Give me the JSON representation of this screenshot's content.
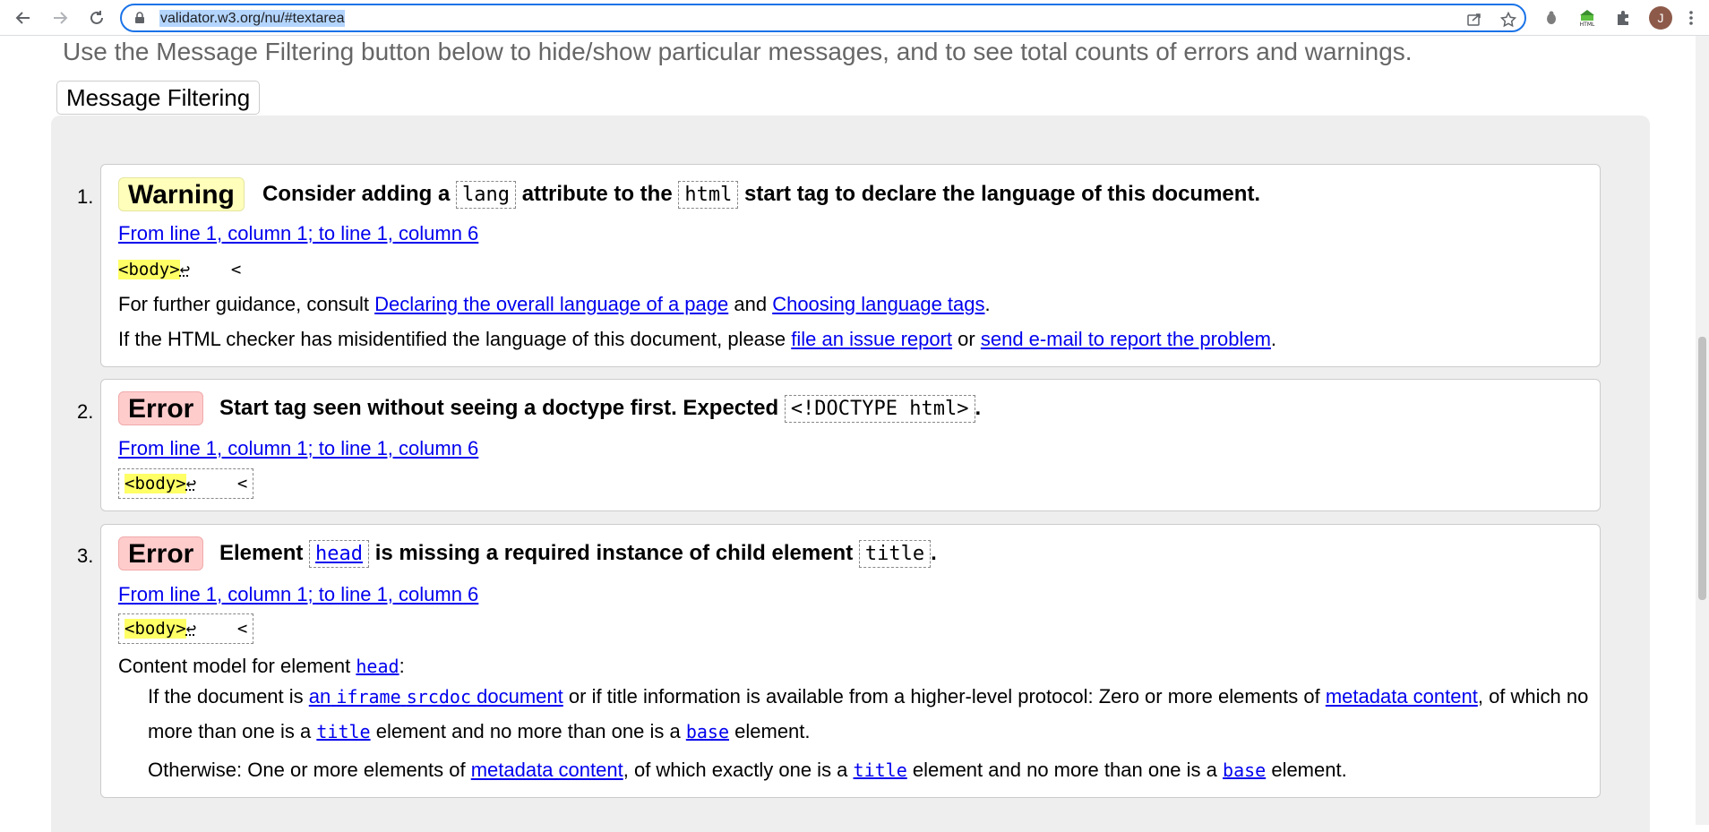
{
  "browser": {
    "url": "validator.w3.org/nu/#textarea",
    "avatar_letter": "J"
  },
  "page": {
    "intro": "Use the Message Filtering button below to hide/show particular messages, and to see total counts of errors and warnings.",
    "filter_button": "Message Filtering"
  },
  "messages": [
    {
      "number": "1.",
      "type": "Warning",
      "text_parts": [
        "Consider adding a",
        "lang",
        "attribute to the",
        "html",
        "start tag to declare the language of this document."
      ],
      "location": "From line 1, column 1; to line 1, column 6",
      "extract_tag": "<body>",
      "extract_ret": "↩",
      "extract_tail": "    <",
      "guidance": {
        "prefix": "For further guidance, consult",
        "link1": "Declaring the overall language of a page",
        "mid": "and",
        "link2": "Choosing language tags",
        "suffix": "."
      },
      "misidentified": {
        "prefix": "If the HTML checker has misidentified the language of this document, please",
        "link1": "file an issue report",
        "mid": "or",
        "link2": "send e-mail to report the problem",
        "suffix": "."
      }
    },
    {
      "number": "2.",
      "type": "Error",
      "text_parts": [
        "Start tag seen without seeing a doctype first. Expected",
        "<!DOCTYPE html>",
        "."
      ],
      "location": "From line 1, column 1; to line 1, column 6",
      "extract_tag": "<body>",
      "extract_ret": "↩",
      "extract_tail": "    <"
    },
    {
      "number": "3.",
      "type": "Error",
      "text_parts": [
        "Element",
        "head",
        "is missing a required instance of child element",
        "title",
        "."
      ],
      "location": "From line 1, column 1; to line 1, column 6",
      "extract_tag": "<body>",
      "extract_ret": "↩",
      "extract_tail": "    <",
      "content_model": {
        "prefix": "Content model for element",
        "element": "head",
        "suffix": ":",
        "line1_a": "If the document is",
        "line1_link_a": "an",
        "line1_link_code": "iframe",
        "line1_link_code2": "srcdoc",
        "line1_link_b": "document",
        "line1_b": "or if title information is available from a higher-level protocol: Zero or more elements of",
        "line1_link_c": "metadata content",
        "line1_c": ", of which no",
        "line2_a": "more than one is a",
        "line2_code1": "title",
        "line2_b": "element and no more than one is a",
        "line2_code2": "base",
        "line2_c": "element.",
        "line3_a": "Otherwise: One or more elements of",
        "line3_link": "metadata content",
        "line3_b": ", of which exactly one is a",
        "line3_code1": "title",
        "line3_c": "element and no more than one is a",
        "line3_code2": "base",
        "line3_d": "element."
      }
    }
  ]
}
